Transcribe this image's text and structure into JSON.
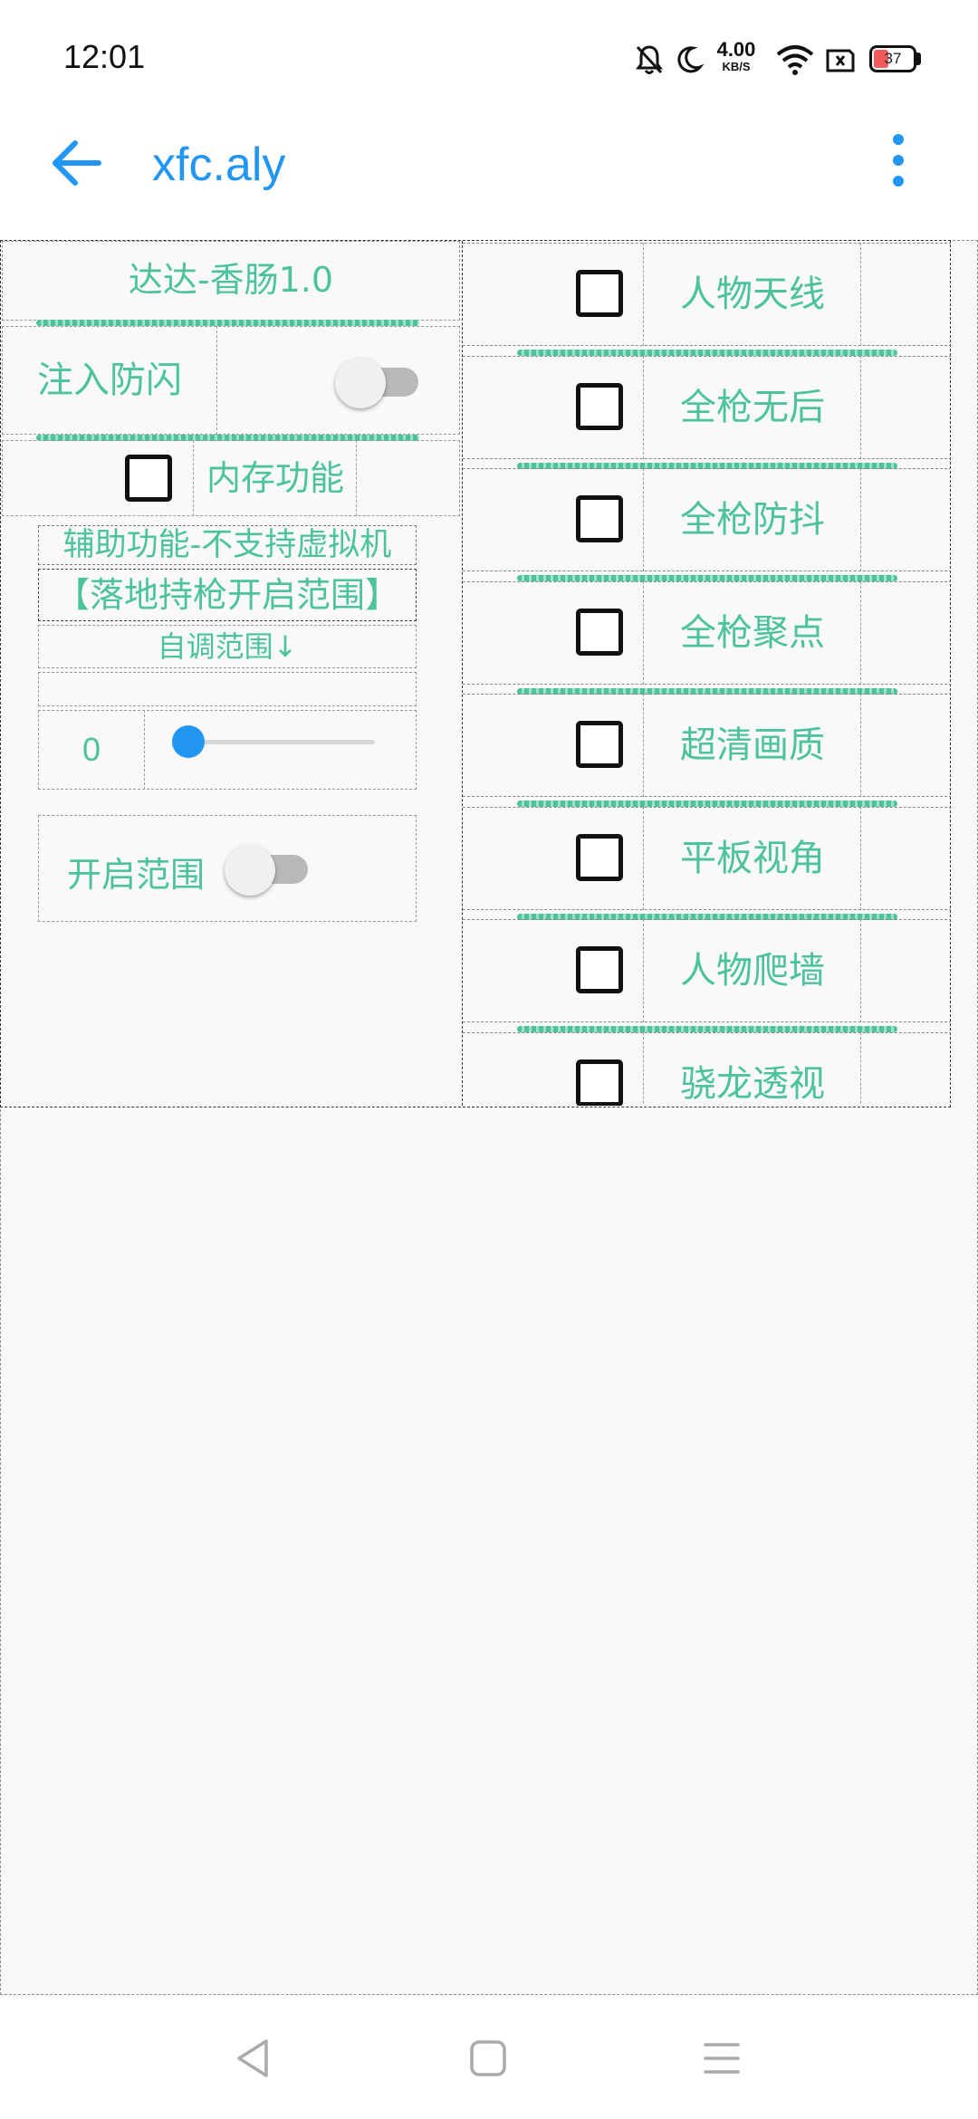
{
  "status_bar": {
    "time": "12:01",
    "net_speed_value": "4.00",
    "net_speed_unit": "KB/S",
    "battery_level": "37",
    "icons": [
      "bell-muted-icon",
      "moon-icon",
      "wifi-icon",
      "sim-off-icon",
      "battery-icon"
    ]
  },
  "app_bar": {
    "title": "xfc.aly",
    "back_icon": "arrow-left-icon",
    "menu_icon": "more-vert-icon",
    "accent_color": "#2196f3"
  },
  "left_panel": {
    "title": "达达-香肠1.0",
    "inject_label": "注入防闪",
    "inject_on": false,
    "memory_label": "内存功能",
    "memory_checked": false,
    "assist_label": "辅助功能-不支持虚拟机",
    "range_header": "【落地持枪开启范围】",
    "adjust_label": "自调范围↓",
    "slider_value": "0",
    "slider_fraction": 0,
    "enable_range_label": "开启范围",
    "enable_range_on": false,
    "text_color": "#4cc39a"
  },
  "right_panel": {
    "items": [
      {
        "label": "人物天线",
        "checked": false
      },
      {
        "label": "全枪无后",
        "checked": false
      },
      {
        "label": "全枪防抖",
        "checked": false
      },
      {
        "label": "全枪聚点",
        "checked": false
      },
      {
        "label": "超清画质",
        "checked": false
      },
      {
        "label": "平板视角",
        "checked": false
      },
      {
        "label": "人物爬墙",
        "checked": false
      },
      {
        "label": "骁龙透视",
        "checked": false
      }
    ]
  },
  "nav_bar": {
    "icons": [
      "nav-back-icon",
      "nav-home-icon",
      "nav-recents-icon"
    ]
  }
}
